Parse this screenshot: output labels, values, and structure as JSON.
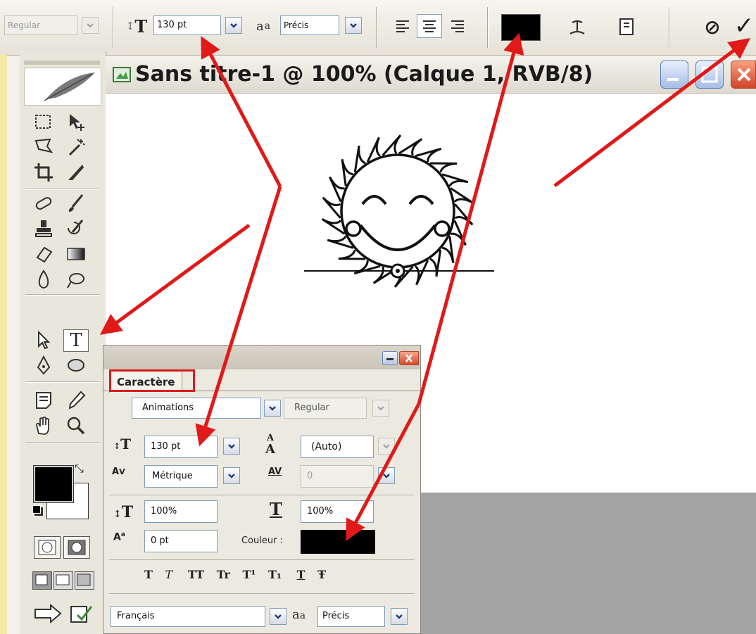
{
  "options_bar": {
    "font_style": "Regular",
    "font_size": "130 pt",
    "antialias_label": "a",
    "antialias_label_sub": "a",
    "antialias": "Précis",
    "text_color": "#000000",
    "commit_icon": "✓",
    "cancel_icon": "⊘"
  },
  "document": {
    "title": "Sans titre-1 @ 100% (Calque 1, RVB/8)"
  },
  "character_panel": {
    "tab": "Caractère",
    "font_family": "Animations",
    "font_style": "Regular",
    "size": "130 pt",
    "leading": "(Auto)",
    "kerning": "Métrique",
    "tracking": "0",
    "vertical_scale": "100%",
    "horizontal_scale": "100%",
    "baseline_shift": "0 pt",
    "color_label": "Couleur :",
    "color": "#000000",
    "style_buttons": [
      "T",
      "T",
      "TT",
      "Tr",
      "T¹",
      "T₁",
      "T",
      "Ŧ"
    ],
    "language": "Français",
    "antialias_label": "a",
    "antialias_label_sub": "a",
    "antialias": "Précis"
  },
  "colors": {
    "arrow_red": "#e01919",
    "highlight_red": "#d81c1c"
  }
}
